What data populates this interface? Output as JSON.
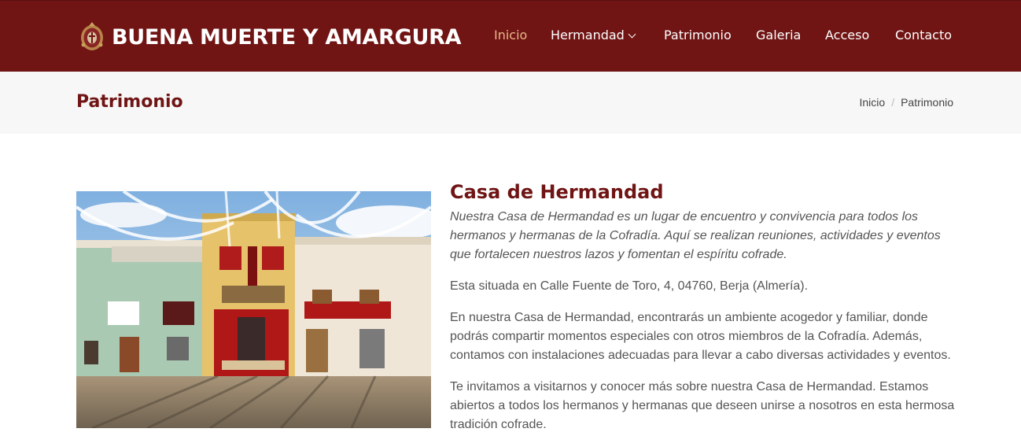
{
  "header": {
    "brand_name": "BUENA MUERTE Y AMARGURA",
    "logo_icon": "brotherhood-crest-icon",
    "nav": [
      {
        "label": "Inicio",
        "active": true
      },
      {
        "label": "Hermandad",
        "dropdown": true
      },
      {
        "label": "Patrimonio"
      },
      {
        "label": "Galeria"
      },
      {
        "label": "Acceso"
      },
      {
        "label": "Contacto"
      }
    ]
  },
  "titlebar": {
    "title": "Patrimonio",
    "breadcrumb": [
      {
        "label": "Inicio"
      },
      {
        "label": "Patrimonio"
      }
    ],
    "separator": "/"
  },
  "main": {
    "image_subject": "street-altar-photo",
    "section_title": "Casa de Hermandad",
    "paragraphs": [
      "Nuestra Casa de Hermandad es un lugar de encuentro y convivencia para todos los hermanos y hermanas de la Cofradía. Aquí se realizan reuniones, actividades y eventos que fortalecen nuestros lazos y fomentan el espíritu cofrade.",
      "Esta situada en Calle Fuente de Toro, 4, 04760, Berja (Almería).",
      "En nuestra Casa de Hermandad, encontrarás un ambiente acogedor y familiar, donde podrás compartir momentos especiales con otros miembros de la Cofradía. Además, contamos con instalaciones adecuadas para llevar a cabo diversas actividades y eventos.",
      "Te invitamos a visitarnos y conocer más sobre nuestra Casa de Hermandad. Estamos abiertos a todos los hermanos y hermanas que deseen unirse a nosotros en esta hermosa tradición cofrade."
    ]
  },
  "colors": {
    "brand": "#701414",
    "nav_active": "#e9b88a",
    "titlebar_bg": "#f7f7f7",
    "body_text": "#555555"
  }
}
